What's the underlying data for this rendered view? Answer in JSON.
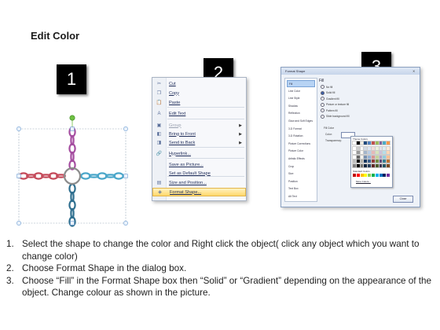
{
  "title": "Edit Color",
  "step_numbers": [
    "1",
    "2",
    "3"
  ],
  "context_menu": {
    "items": [
      {
        "label": "Cut",
        "icon": "scissors-icon",
        "glyph": "✂",
        "enabled": true,
        "submenu": false
      },
      {
        "label": "Copy",
        "icon": "copy-icon",
        "glyph": "❐",
        "enabled": true,
        "submenu": false
      },
      {
        "label": "Paste",
        "icon": "paste-icon",
        "glyph": "📋",
        "enabled": true,
        "submenu": false
      },
      {
        "label": "Edit Text",
        "icon": "edit-text-icon",
        "glyph": "A",
        "enabled": true,
        "submenu": false
      },
      {
        "label": "Group",
        "icon": "group-icon",
        "glyph": "▣",
        "enabled": false,
        "submenu": true
      },
      {
        "label": "Bring to Front",
        "icon": "bring-to-front-icon",
        "glyph": "◧",
        "enabled": true,
        "submenu": true
      },
      {
        "label": "Send to Back",
        "icon": "send-to-back-icon",
        "glyph": "◨",
        "enabled": true,
        "submenu": true
      },
      {
        "label": "Hyperlink...",
        "icon": "hyperlink-icon",
        "glyph": "🔗",
        "enabled": true,
        "submenu": false
      },
      {
        "label": "Save as Picture...",
        "icon": "",
        "glyph": "",
        "enabled": true,
        "submenu": false
      },
      {
        "label": "Set as Default Shape",
        "icon": "",
        "glyph": "",
        "enabled": true,
        "submenu": false
      },
      {
        "label": "Size and Position...",
        "icon": "size-position-icon",
        "glyph": "▤",
        "enabled": true,
        "submenu": false
      },
      {
        "label": "Format Shape...",
        "icon": "format-shape-icon",
        "glyph": "◈",
        "enabled": true,
        "submenu": false,
        "highlighted": true
      }
    ]
  },
  "dialog": {
    "title": "Format Shape",
    "nav": [
      "Fill",
      "Line Color",
      "Line Style",
      "Shadow",
      "Reflection",
      "Glow and Soft Edges",
      "3-D Format",
      "3-D Rotation",
      "Picture Corrections",
      "Picture Color",
      "Artistic Effects",
      "Crop",
      "Size",
      "Position",
      "Text Box",
      "Alt Text"
    ],
    "selected_nav": "Fill",
    "panel_heading": "Fill",
    "fill_options": [
      "No fill",
      "Solid fill",
      "Gradient fill",
      "Picture or texture fill",
      "Pattern fill",
      "Slide background fill"
    ],
    "selected_option": "Solid fill",
    "fill_color_label": "Fill Color",
    "color_label": "Color:",
    "transparency_label": "Transparency:",
    "theme_colors_label": "Theme Colors",
    "standard_colors_label": "Standard Colors",
    "more_colors_label": "More Colors...",
    "close_label": "Close",
    "theme_colors": [
      "#ffffff",
      "#000000",
      "#eeece1",
      "#1f497d",
      "#4f81bd",
      "#c0504d",
      "#9bbb59",
      "#8064a2",
      "#4bacc6",
      "#f79646"
    ],
    "standard_colors": [
      "#c00000",
      "#ff0000",
      "#ffc000",
      "#ffff00",
      "#92d050",
      "#00b050",
      "#00b0f0",
      "#0070c0",
      "#002060",
      "#7030a0"
    ]
  },
  "steps": [
    {
      "num": "1.",
      "text": "Select the shape to change the color and Right click the object( click any object which you want to change color)"
    },
    {
      "num": "2.",
      "text": "Choose Format Shape in the dialog box."
    },
    {
      "num": "3.",
      "text": "Choose “Fill” in the Format Shape box then “Solid” or “Gradient” depending on the appearance of the object. Change colour as shown in the picture."
    }
  ],
  "colors": {
    "chain_top": "#a54da0",
    "chain_left": "#c44a5a",
    "chain_right": "#4aa6c9",
    "chain_bottom": "#2f6f8f",
    "selection_handle": "#7ea8d8",
    "rotation_handle": "#6fc043",
    "menu_highlight": "#ffd76a"
  }
}
